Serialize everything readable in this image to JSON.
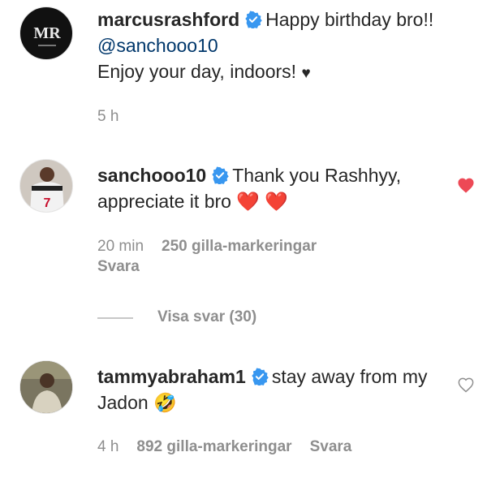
{
  "comments": [
    {
      "username": "marcusrashford",
      "avatar_monogram": "MR",
      "text_parts": [
        "Happy birthday bro!! ",
        "@sanchooo10",
        " Enjoy your day, indoors! ",
        "♥"
      ],
      "time": "5 h",
      "liked": false
    },
    {
      "username": "sanchooo10",
      "avatar_number": "7",
      "text": "Thank you Rashhyy, appreciate it bro ",
      "emoji": "❤️ ❤️",
      "time": "20 min",
      "likes": "250 gilla-markeringar",
      "reply_label": "Svara",
      "liked": true
    },
    {
      "username": "tammyabraham1",
      "text": "stay away from my Jadon ",
      "emoji": "🤣",
      "time": "4 h",
      "likes": "892 gilla-markeringar",
      "reply_label": "Svara",
      "liked": false
    }
  ],
  "view_replies": "Visa svar (30)",
  "colors": {
    "verified": "#3897f0",
    "heart_liked": "#ed4956",
    "meta": "#8e8e8e",
    "mention": "#00376b"
  },
  "icons": {
    "verified": "verified-badge-icon",
    "like": "heart-icon"
  }
}
